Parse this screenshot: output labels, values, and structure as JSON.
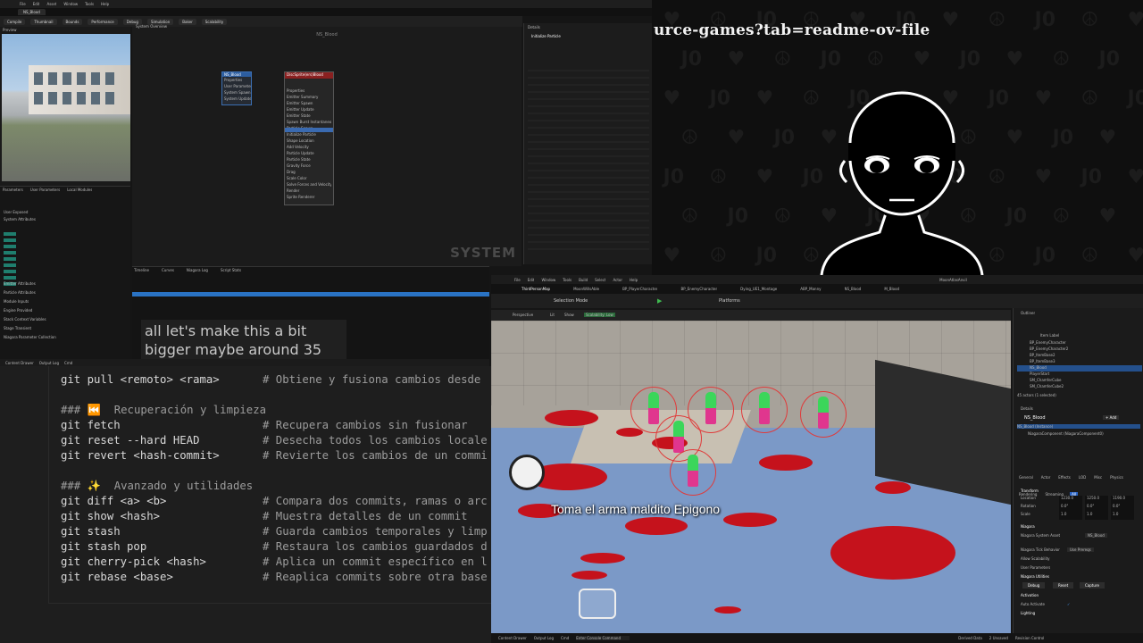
{
  "niagara": {
    "menu": [
      "File",
      "Edit",
      "Asset",
      "Window",
      "Tools",
      "Help"
    ],
    "tab": "NS_Blood",
    "toolbar": [
      "Compile",
      "Thumbnail",
      "Bounds",
      "Performance",
      "Debug",
      "Simulation",
      "Baker",
      "Scalability"
    ],
    "preview_label": "Preview",
    "params_tabs": [
      "Parameters",
      "User Parameters",
      "Local Modules"
    ],
    "param_sections": [
      "User Exposed",
      "System Attributes",
      "Emitter Attributes",
      "Particle Attributes",
      "Module Inputs",
      "Engine Provided",
      "Stack Context Variables",
      "Stage Transient",
      "Niagara Parameter Collection"
    ],
    "system_overview_tab": "System Overview",
    "graph_title": "NS_Blood",
    "watermark": "SYSTEM",
    "emitter_node_title": "NS_Blood",
    "emitter_node_rows": [
      "Properties",
      "User Parameters",
      "System Spawn",
      "System Update"
    ],
    "system_node_title": "DiscSprite(ers)Blood",
    "system_node_rows": [
      "Properties",
      "Emitter Summary",
      "Emitter Spawn",
      "Emitter Update",
      "Emitter State",
      "Spawn Burst Instantaneous",
      "Particle Spawn",
      "Initialize Particle",
      "Shape Location",
      "Add Velocity",
      "Particle Update",
      "Particle State",
      "Gravity Force",
      "Drag",
      "Scale Color",
      "Solve Forces and Velocity",
      "Render",
      "Sprite Renderer"
    ],
    "details_title": "Details",
    "details_item": "Initialize Particle",
    "timeline_tabs": [
      "Timeline",
      "Curves",
      "Niagara Log",
      "Script Stats"
    ],
    "taskbar": [
      "Content Drawer",
      "Output Log",
      "Cmd"
    ],
    "subtitle": "all let's make this a bit bigger maybe around 35"
  },
  "cam": {
    "url_fragment": "urce-games?tab=readme-ov-file"
  },
  "code": {
    "lines": [
      {
        "cmd": "git pull <remoto> <rama>",
        "comment": "# Obtiene y fusiona cambios desde"
      },
      {
        "cmd": "",
        "comment": ""
      },
      {
        "cmd": "",
        "comment": "### ⏮️  Recuperación y limpieza"
      },
      {
        "cmd": "git fetch",
        "comment": "# Recupera cambios sin fusionar"
      },
      {
        "cmd": "git reset --hard HEAD",
        "comment": "# Desecha todos los cambios locale"
      },
      {
        "cmd": "git revert <hash-commit>",
        "comment": "# Revierte los cambios de un commi"
      },
      {
        "cmd": "",
        "comment": ""
      },
      {
        "cmd": "",
        "comment": "### ✨  Avanzado y utilidades"
      },
      {
        "cmd": "git diff <a> <b>",
        "comment": "# Compara dos commits, ramas o arc"
      },
      {
        "cmd": "git show <hash>",
        "comment": "# Muestra detalles de un commit"
      },
      {
        "cmd": "git stash",
        "comment": "# Guarda cambios temporales y limp"
      },
      {
        "cmd": "git stash pop",
        "comment": "# Restaura los cambios guardados d"
      },
      {
        "cmd": "git cherry-pick <hash>",
        "comment": "# Aplica un commit específico en l"
      },
      {
        "cmd": "git rebase <base>",
        "comment": "# Reaplica commits sobre otra base"
      }
    ]
  },
  "ue": {
    "menu": [
      "File",
      "Edit",
      "Window",
      "Tools",
      "Build",
      "Select",
      "Actor",
      "Help"
    ],
    "project": "MoonAtlasAnvil",
    "tabs": [
      "ThirdPersonMap",
      "MoonWillsAble",
      "BP_PlayerCharacter",
      "BP_EnemyCharacter",
      "Dying_UE1_Montage",
      "ABP_Manny",
      "NS_Blood",
      "M_Blood"
    ],
    "toolbar": [
      "Selection Mode",
      "Platforms"
    ],
    "viewport_bar": [
      "Perspective",
      "Lit",
      "Show",
      "Scalability: Low"
    ],
    "in_game_text": "Toma el arma maldito Epigono",
    "outliner_title": "Outliner",
    "outliner_col": "Item Label",
    "outliner_items": [
      "BP_EnemyCharacter",
      "BP_EnemyCharacter2",
      "BP_ItemBase2",
      "BP_ItemBase3",
      "NS_Blood",
      "PlayerStart",
      "SM_ChamferCube",
      "SM_ChamferCube2"
    ],
    "outliner_selected_index": 4,
    "outliner_count": "45 actors (1 selected)",
    "details_title": "Details",
    "details_name": "NS_Blood",
    "details_add": "+ Add",
    "details_instance": "NS_Blood (Instance)",
    "details_component": "NiagaraComponent (NiagaraComponent0)",
    "details_filter_tabs": [
      "General",
      "Actor",
      "Effects",
      "LOD",
      "Misc",
      "Physics",
      "Rendering",
      "Streaming",
      "All"
    ],
    "transform_label": "Transform",
    "transform_rows": [
      {
        "label": "Location",
        "values": [
          "1230.0",
          "1250.0",
          "1190.0"
        ]
      },
      {
        "label": "Rotation",
        "values": [
          "0.0°",
          "0.0°",
          "0.0°"
        ]
      },
      {
        "label": "Scale",
        "values": [
          "1.0",
          "1.0",
          "1.0"
        ]
      }
    ],
    "niagara_section": "Niagara",
    "niagara_rows": [
      "Niagara System Asset",
      "Niagara Tick Behavior",
      "Allow Scalability",
      "User Parameters"
    ],
    "niagara_asset": "NS_Blood",
    "tick_behavior": "Use Prereqs",
    "utilities_label": "Niagara Utilities",
    "utility_buttons": [
      "Debug",
      "Reset",
      "Capture"
    ],
    "activation_label": "Activation",
    "auto_activate": "Auto Activate",
    "lighting_label": "Lighting",
    "status": [
      "Content Drawer",
      "Output Log",
      "Cmd",
      "Enter Console Command",
      "Derived Data",
      "2 Unsaved",
      "Revision Control"
    ]
  }
}
